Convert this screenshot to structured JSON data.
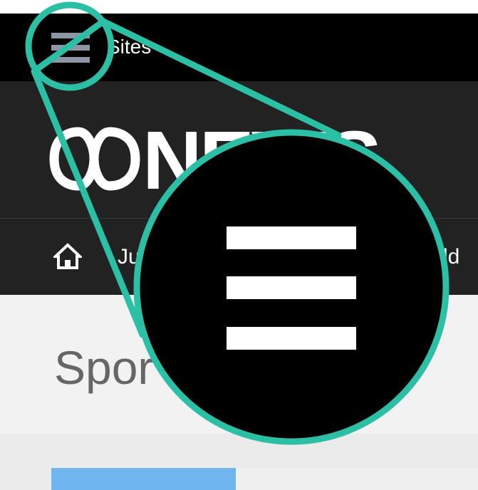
{
  "topbar": {
    "sites_label": "Sites"
  },
  "masthead": {
    "brand_text": "NEWS"
  },
  "nav": {
    "items": [
      {
        "label": "Ju"
      },
      {
        "label": "rld"
      }
    ]
  },
  "main": {
    "section_title": "Spor"
  },
  "colors": {
    "topbar_bg": "#000000",
    "masthead_bg": "#222222",
    "callout_teal": "#2bbfa5",
    "tab_active": "#6fb6ef",
    "hamburger_small": "#8e96a6"
  },
  "icons": {
    "menu": "hamburger-icon",
    "home": "home-icon",
    "logo": "abc-logo"
  }
}
